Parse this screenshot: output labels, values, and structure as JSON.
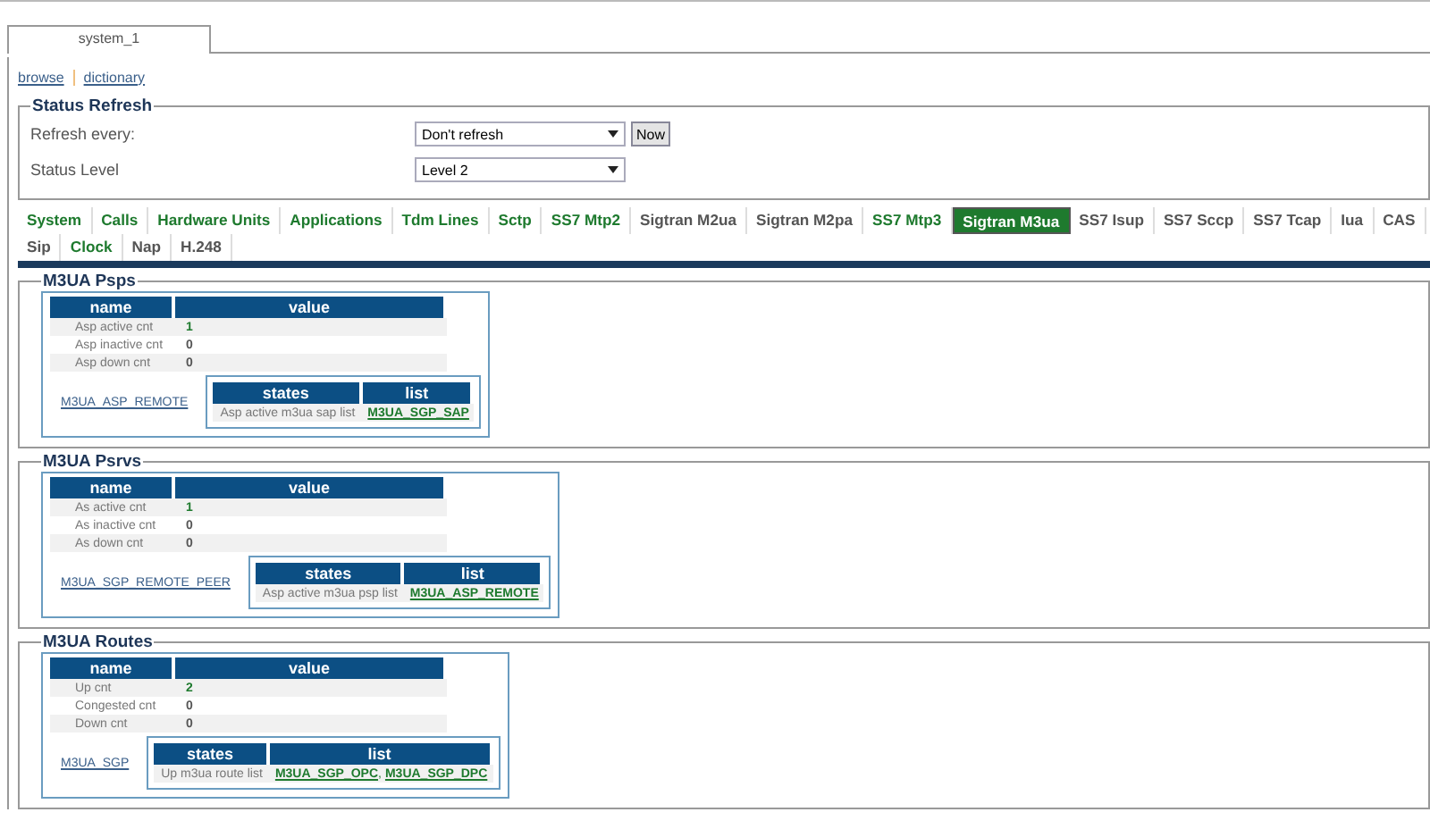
{
  "window_tab": {
    "label": "system_1",
    "selected": true
  },
  "nav_links": [
    "browse",
    "dictionary"
  ],
  "status_refresh": {
    "title": "Status Refresh",
    "fields": [
      {
        "label": "Refresh every:",
        "value": "Don't refresh",
        "button": "Now"
      },
      {
        "label": "Status Level",
        "value": "Level 2"
      }
    ]
  },
  "list_separator": ",",
  "tabs": [
    {
      "label": "System",
      "selected": false,
      "color": "#1e7a2e"
    },
    {
      "label": "Calls",
      "selected": false,
      "color": "#1e7a2e"
    },
    {
      "label": "Hardware Units",
      "selected": false,
      "color": "#1e7a2e"
    },
    {
      "label": "Applications",
      "selected": false,
      "color": "#1e7a2e"
    },
    {
      "label": "Tdm Lines",
      "selected": false,
      "color": "#1e7a2e"
    },
    {
      "label": "Sctp",
      "selected": false,
      "color": "#1e7a2e"
    },
    {
      "label": "SS7 Mtp2",
      "selected": false,
      "color": "#1e7a2e"
    },
    {
      "label": "Sigtran M2ua",
      "selected": false,
      "color": "#555555"
    },
    {
      "label": "Sigtran M2pa",
      "selected": false,
      "color": "#555555"
    },
    {
      "label": "SS7 Mtp3",
      "selected": false,
      "color": "#1e7a2e"
    },
    {
      "label": "Sigtran M3ua",
      "selected": true,
      "color": "#1e7a2e"
    },
    {
      "label": "SS7 Isup",
      "selected": false,
      "color": "#555555"
    },
    {
      "label": "SS7 Sccp",
      "selected": false,
      "color": "#555555"
    },
    {
      "label": "SS7 Tcap",
      "selected": false,
      "color": "#555555"
    },
    {
      "label": "Iua",
      "selected": false,
      "color": "#555555"
    },
    {
      "label": "CAS",
      "selected": false,
      "color": "#555555"
    },
    {
      "label": "Sip",
      "selected": false,
      "color": "#555555"
    },
    {
      "label": "Clock",
      "selected": false,
      "color": "#1e7a2e"
    },
    {
      "label": "Nap",
      "selected": false,
      "color": "#555555"
    },
    {
      "label": "H.248",
      "selected": false,
      "color": "#555555"
    }
  ],
  "sections": [
    {
      "title": "M3UA Psps",
      "columns": [
        "name",
        "value"
      ],
      "rows": [
        {
          "name": "Asp active cnt",
          "value": "1",
          "color": "#1e7a2e"
        },
        {
          "name": "Asp inactive cnt",
          "value": "0",
          "color": "#555555"
        },
        {
          "name": "Asp down cnt",
          "value": "0",
          "color": "#555555"
        }
      ],
      "link": "M3UA_ASP_REMOTE",
      "states_columns": [
        "states",
        "list"
      ],
      "state": "Asp active m3ua sap list",
      "list": [
        "M3UA_SGP_SAP"
      ]
    },
    {
      "title": "M3UA Psrvs",
      "columns": [
        "name",
        "value"
      ],
      "rows": [
        {
          "name": "As active cnt",
          "value": "1",
          "color": "#1e7a2e"
        },
        {
          "name": "As inactive cnt",
          "value": "0",
          "color": "#555555"
        },
        {
          "name": "As down cnt",
          "value": "0",
          "color": "#555555"
        }
      ],
      "link": "M3UA_SGP_REMOTE_PEER",
      "states_columns": [
        "states",
        "list"
      ],
      "state": "Asp active m3ua psp list",
      "list": [
        "M3UA_ASP_REMOTE"
      ]
    },
    {
      "title": "M3UA Routes",
      "columns": [
        "name",
        "value"
      ],
      "rows": [
        {
          "name": "Up cnt",
          "value": "2",
          "color": "#1e7a2e"
        },
        {
          "name": "Congested cnt",
          "value": "0",
          "color": "#555555"
        },
        {
          "name": "Down cnt",
          "value": "0",
          "color": "#555555"
        }
      ],
      "link": "M3UA_SGP",
      "states_columns": [
        "states",
        "list"
      ],
      "state": "Up m3ua route list",
      "list": [
        "M3UA_SGP_OPC",
        "M3UA_SGP_DPC"
      ]
    }
  ]
}
